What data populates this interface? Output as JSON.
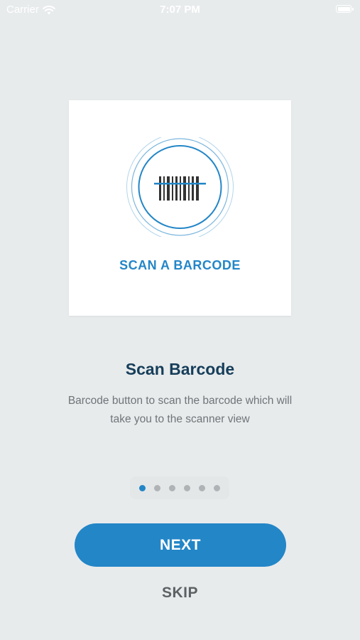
{
  "status_bar": {
    "carrier": "Carrier",
    "time": "7:07 PM",
    "wifi_icon": "wifi-icon",
    "battery_icon": "battery-icon"
  },
  "illustration": {
    "icon": "barcode-scan-icon",
    "caption": "SCAN A BARCODE"
  },
  "content": {
    "title": "Scan Barcode",
    "description": "Barcode button to scan the barcode which will take you to the scanner view"
  },
  "pager": {
    "total": 6,
    "active_index": 0
  },
  "actions": {
    "next_label": "NEXT",
    "skip_label": "SKIP"
  },
  "colors": {
    "accent": "#2386c7",
    "background": "#e8ebec",
    "title": "#163e5a"
  }
}
